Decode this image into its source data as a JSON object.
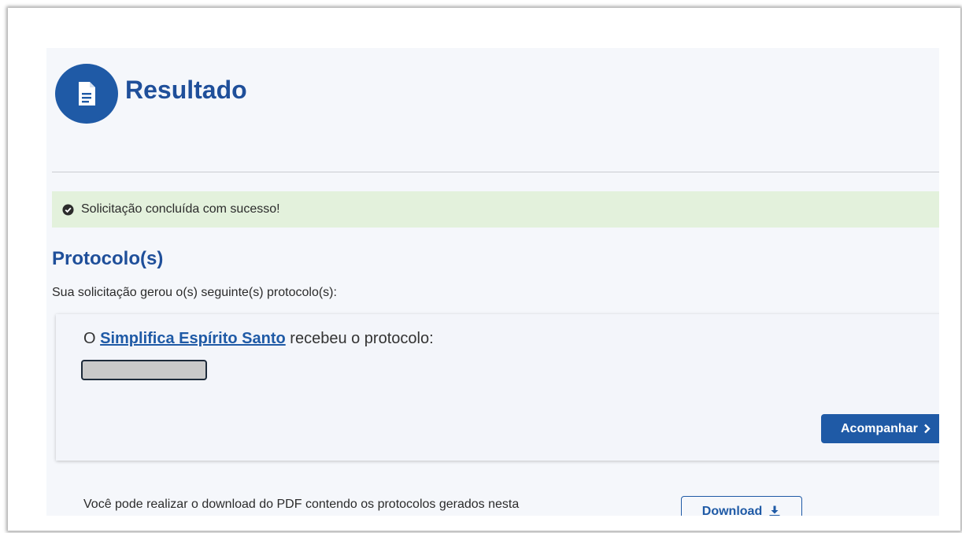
{
  "header": {
    "title": "Resultado",
    "icon": "document-icon"
  },
  "alert": {
    "icon": "check-circle-icon",
    "text": "Solicitação concluída com sucesso!",
    "color": "#e3f1dc"
  },
  "protocols": {
    "title": "Protocolo(s)",
    "description": "Sua solicitação gerou o(s) seguinte(s) protocolo(s):",
    "card": {
      "prefix": "O",
      "link_text": "Simplifica Espírito Santo",
      "suffix": "recebeu o protocolo:",
      "protocol_value": "",
      "track_button_label": "Acompanhar"
    }
  },
  "download": {
    "text": "Você pode realizar o download do PDF contendo os protocolos gerados nesta",
    "button_label": "Download",
    "button_icon": "download-icon"
  },
  "colors": {
    "brand": "#1f5aa6",
    "title": "#1f4f9a",
    "success_bg": "#e3f1dc"
  }
}
